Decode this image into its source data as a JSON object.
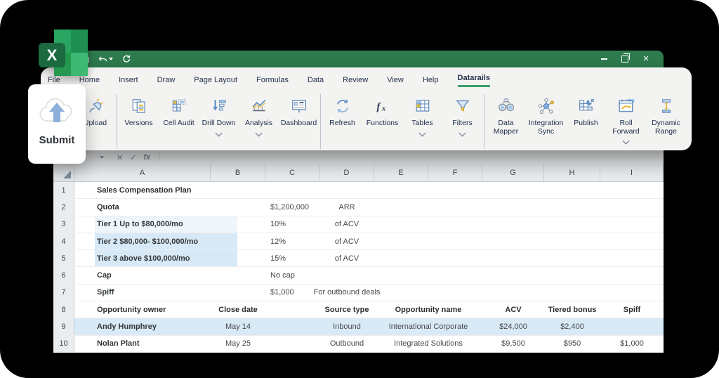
{
  "window": {
    "quick_access": [
      "save-icon",
      "undo-icon",
      "redo-icon"
    ],
    "controls": {
      "minimize": "–",
      "maximize": "",
      "close": "×"
    }
  },
  "tabs": [
    {
      "label": "File",
      "active": false
    },
    {
      "label": "Home",
      "active": false
    },
    {
      "label": "Insert",
      "active": false
    },
    {
      "label": "Draw",
      "active": false
    },
    {
      "label": "Page Layout",
      "active": false
    },
    {
      "label": "Formulas",
      "active": false
    },
    {
      "label": "Data",
      "active": false
    },
    {
      "label": "Review",
      "active": false
    },
    {
      "label": "View",
      "active": false
    },
    {
      "label": "Help",
      "active": false
    },
    {
      "label": "Datarails",
      "active": true
    }
  ],
  "ribbon": {
    "accent_underline_color": "#3aa169",
    "groups": [
      {
        "buttons": [
          {
            "label": "Upload",
            "icon": "plug-icon",
            "chevron": false
          }
        ]
      },
      {
        "buttons": [
          {
            "label": "Versions",
            "icon": "versions-icon",
            "chevron": false
          },
          {
            "label": "Cell Audit",
            "icon": "cell-audit-icon",
            "chevron": false
          },
          {
            "label": "Drill Down",
            "icon": "drill-down-icon",
            "chevron": true
          },
          {
            "label": "Analysis",
            "icon": "analysis-icon",
            "chevron": true
          },
          {
            "label": "Dashboard",
            "icon": "dashboard-icon",
            "chevron": false
          }
        ]
      },
      {
        "buttons": [
          {
            "label": "Refresh",
            "icon": "refresh-icon",
            "chevron": false
          },
          {
            "label": "Functions",
            "icon": "functions-icon",
            "chevron": false
          },
          {
            "label": "Tables",
            "icon": "tables-icon",
            "chevron": true
          },
          {
            "label": "Filters",
            "icon": "filters-icon",
            "chevron": true
          }
        ]
      },
      {
        "buttons": [
          {
            "label": "Data\nMapper",
            "icon": "data-mapper-icon",
            "chevron": false
          },
          {
            "label": "Integration\nSync",
            "icon": "integration-sync-icon",
            "chevron": false
          },
          {
            "label": "Publish",
            "icon": "publish-icon",
            "chevron": false
          },
          {
            "label": "Roll\nForward",
            "icon": "roll-forward-icon",
            "chevron": true
          },
          {
            "label": "Dynamic\nRange",
            "icon": "dynamic-range-icon",
            "chevron": false
          }
        ]
      }
    ]
  },
  "submit_card": {
    "label": "Submit",
    "icon": "cloud-upload-icon"
  },
  "formula_bar": {
    "icons": [
      "name-box-dropdown-icon",
      "cancel-icon",
      "confirm-icon",
      "insert-function-icon"
    ],
    "cancel_glyph": "✕",
    "confirm_glyph": "✓",
    "fx_glyph": "fx"
  },
  "sheet": {
    "column_headers": [
      "A",
      "B",
      "C",
      "D",
      "E",
      "F",
      "G",
      "H",
      "I"
    ],
    "rows": [
      {
        "n": "1",
        "highlight": "none",
        "cells": [
          {
            "col": "A",
            "text": "Sales Compensation Plan",
            "style": "b"
          }
        ]
      },
      {
        "n": "2",
        "highlight": "none",
        "cells": [
          {
            "col": "A",
            "text": "Quota",
            "style": "b"
          },
          {
            "col": "C",
            "text": "$1,200,000"
          },
          {
            "col": "D",
            "text": "ARR"
          }
        ]
      },
      {
        "n": "3",
        "highlight": "tier-light",
        "cells": [
          {
            "col": "A",
            "text": "Tier 1 Up to $80,000/mo",
            "style": "sb"
          },
          {
            "col": "C",
            "text": "10%"
          },
          {
            "col": "D",
            "text": "of ACV"
          }
        ]
      },
      {
        "n": "4",
        "highlight": "tier",
        "cells": [
          {
            "col": "A",
            "text": "Tier 2  $80,000- $100,000/mo",
            "style": "sb"
          },
          {
            "col": "C",
            "text": "12%"
          },
          {
            "col": "D",
            "text": "of ACV"
          }
        ]
      },
      {
        "n": "5",
        "highlight": "tier",
        "cells": [
          {
            "col": "A",
            "text": "Tier 3 above $100,000/mo",
            "style": "sb"
          },
          {
            "col": "C",
            "text": "15%"
          },
          {
            "col": "D",
            "text": "of ACV"
          }
        ]
      },
      {
        "n": "6",
        "highlight": "none",
        "cells": [
          {
            "col": "A",
            "text": "Cap",
            "style": "sb"
          },
          {
            "col": "C",
            "text": "No cap"
          }
        ]
      },
      {
        "n": "7",
        "highlight": "none",
        "cells": [
          {
            "col": "A",
            "text": "Spiff",
            "style": "sb"
          },
          {
            "col": "C",
            "text": "$1,000"
          },
          {
            "col": "D",
            "text": "For outbound deals"
          }
        ]
      },
      {
        "n": "8",
        "highlight": "none",
        "cells": [
          {
            "col": "A",
            "text": "Opportunity owner",
            "style": "b"
          },
          {
            "col": "B",
            "text": "Close date",
            "style": "b"
          },
          {
            "col": "D",
            "text": "Source type",
            "style": "b"
          },
          {
            "col": "E",
            "span": 2,
            "text": "Opportunity  name",
            "style": "b"
          },
          {
            "col": "G",
            "text": "ACV",
            "style": "b"
          },
          {
            "col": "H",
            "text": "Tiered bonus",
            "style": "b"
          },
          {
            "col": "I",
            "text": "Spiff",
            "style": "b"
          }
        ]
      },
      {
        "n": "9",
        "highlight": "row",
        "cells": [
          {
            "col": "A",
            "text": "Andy Humphrey",
            "style": "sb"
          },
          {
            "col": "B",
            "text": "May 14"
          },
          {
            "col": "D",
            "text": "Inbound"
          },
          {
            "col": "E",
            "span": 2,
            "text": "International Corporate"
          },
          {
            "col": "G",
            "text": "$24,000"
          },
          {
            "col": "H",
            "text": "$2,400"
          }
        ]
      },
      {
        "n": "10",
        "highlight": "none",
        "cells": [
          {
            "col": "A",
            "text": "Nolan Plant",
            "style": "sb"
          },
          {
            "col": "B",
            "text": "May 25"
          },
          {
            "col": "D",
            "text": "Outbound"
          },
          {
            "col": "E",
            "span": 2,
            "text": "Integrated Solutions"
          },
          {
            "col": "G",
            "text": "$9,500"
          },
          {
            "col": "H",
            "text": "$950"
          },
          {
            "col": "I",
            "text": "$1,000"
          }
        ]
      }
    ],
    "highlight_colors": {
      "tier-light": "#eef5fb",
      "tier": "#d7e9f7",
      "row": "#d9eaf7"
    }
  }
}
